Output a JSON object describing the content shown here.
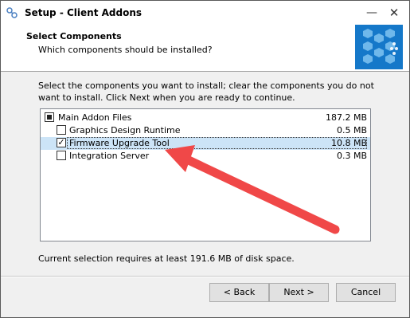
{
  "window": {
    "title": "Setup - Client Addons"
  },
  "header": {
    "title": "Select Components",
    "subtitle": "Which components should be installed?"
  },
  "instructions": "Select the components you want to install; clear the components you do not want to install. Click Next when you are ready to continue.",
  "components": [
    {
      "label": "Main Addon Files",
      "size": "187.2 MB",
      "state": "partial"
    },
    {
      "label": "Graphics Design Runtime",
      "size": "0.5 MB",
      "state": "unchecked"
    },
    {
      "label": "Firmware Upgrade Tool",
      "size": "10.8 MB",
      "state": "checked",
      "selected": true
    },
    {
      "label": "Integration Server",
      "size": "0.3 MB",
      "state": "unchecked"
    }
  ],
  "requirement": "Current selection requires at least 191.6 MB of disk space.",
  "buttons": {
    "back": "< Back",
    "next": "Next >",
    "cancel": "Cancel"
  },
  "icons": {
    "app": "setup-app-icon",
    "minimize": "minimize-icon",
    "close": "close-icon",
    "logo": "setup-logo-icon",
    "annotation": "red-arrow-annotation"
  },
  "colors": {
    "selection": "#cce4f7",
    "logo": "#1578c9",
    "arrow": "#f04848"
  }
}
